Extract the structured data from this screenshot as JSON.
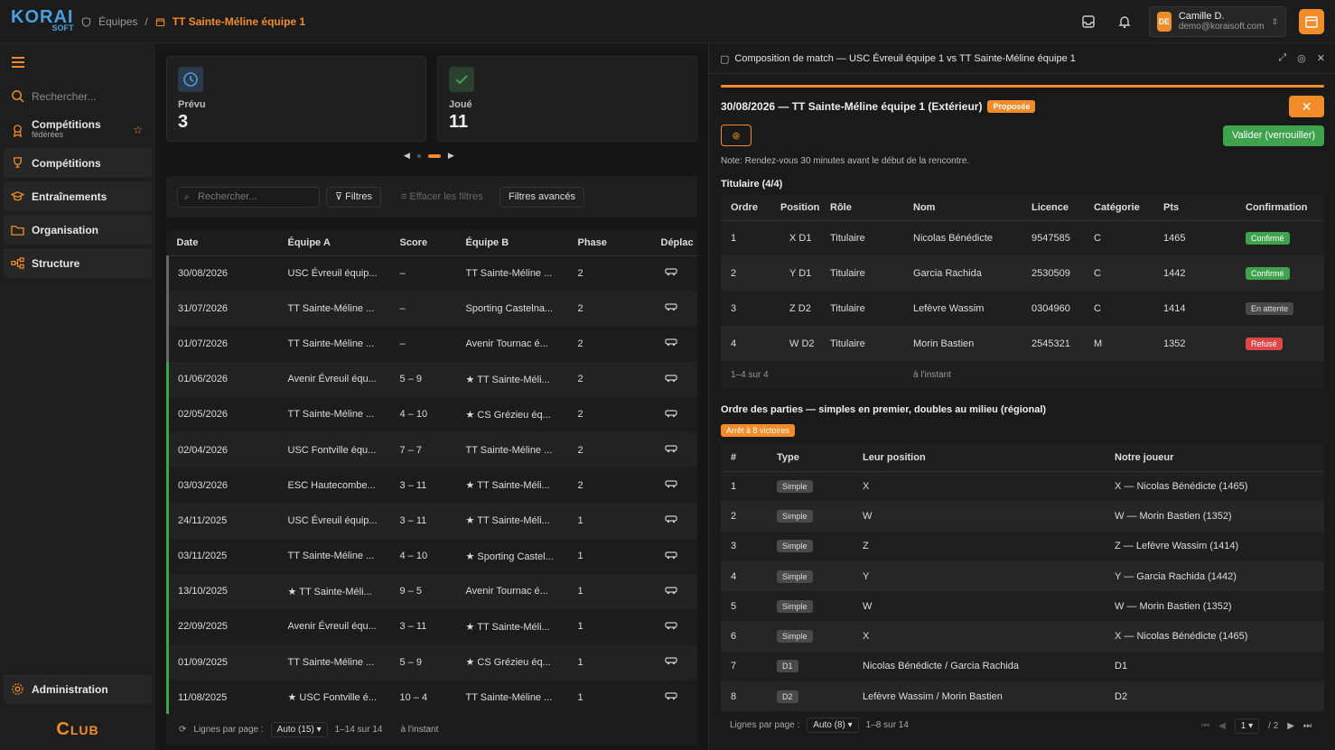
{
  "topbar": {
    "logo": "KORAI",
    "logo_sub": "SOFT",
    "breadcrumb": [
      "Équipes",
      "TT Sainte-Méline équipe 1"
    ],
    "user_initials": "DE",
    "user_name": "Camille D.",
    "user_email": "demo@koraisoft.com"
  },
  "sidebar": {
    "search_placeholder": "Rechercher...",
    "fed_label": "Compétitions",
    "fed_sub": "fédérées",
    "items": [
      "Compétitions",
      "Entraînements",
      "Organisation",
      "Structure"
    ],
    "admin": "Administration",
    "club": "Club"
  },
  "stats": [
    {
      "label": "Prévu",
      "value": "3"
    },
    {
      "label": "Joué",
      "value": "11"
    }
  ],
  "filters": {
    "search_placeholder": "Rechercher...",
    "filters": "Filtres",
    "clear": "Effacer les filtres",
    "advanced": "Filtres avancés"
  },
  "matches": {
    "columns": [
      "Date",
      "Équipe A",
      "Score",
      "Équipe B",
      "Phase",
      "Déplac"
    ],
    "rows": [
      {
        "date": "30/08/2026",
        "a": "USC Évreuil équip...",
        "score": "–",
        "b": "TT Sainte-Méline ...",
        "phase": "2",
        "played": false
      },
      {
        "date": "31/07/2026",
        "a": "TT Sainte-Méline ...",
        "score": "–",
        "b": "Sporting Castelna...",
        "phase": "2",
        "played": false
      },
      {
        "date": "01/07/2026",
        "a": "TT Sainte-Méline ...",
        "score": "–",
        "b": "Avenir Tournac é...",
        "phase": "2",
        "played": false
      },
      {
        "date": "01/06/2026",
        "a": "Avenir Évreuil équ...",
        "score": "5 – 9",
        "b": "★ TT Sainte-Méli...",
        "phase": "2",
        "played": true
      },
      {
        "date": "02/05/2026",
        "a": "TT Sainte-Méline ...",
        "score": "4 – 10",
        "b": "★ CS Grézieu éq...",
        "phase": "2",
        "played": true
      },
      {
        "date": "02/04/2026",
        "a": "USC Fontville équ...",
        "score": "7 – 7",
        "b": "TT Sainte-Méline ...",
        "phase": "2",
        "played": true
      },
      {
        "date": "03/03/2026",
        "a": "ESC Hautecombe...",
        "score": "3 – 11",
        "b": "★ TT Sainte-Méli...",
        "phase": "2",
        "played": true
      },
      {
        "date": "24/11/2025",
        "a": "USC Évreuil équip...",
        "score": "3 – 11",
        "b": "★ TT Sainte-Méli...",
        "phase": "1",
        "played": true
      },
      {
        "date": "03/11/2025",
        "a": "TT Sainte-Méline ...",
        "score": "4 – 10",
        "b": "★ Sporting Castel...",
        "phase": "1",
        "played": true
      },
      {
        "date": "13/10/2025",
        "a": "★ TT Sainte-Méli...",
        "score": "9 – 5",
        "b": "Avenir Tournac é...",
        "phase": "1",
        "played": true
      },
      {
        "date": "22/09/2025",
        "a": "Avenir Évreuil équ...",
        "score": "3 – 11",
        "b": "★ TT Sainte-Méli...",
        "phase": "1",
        "played": true
      },
      {
        "date": "01/09/2025",
        "a": "TT Sainte-Méline ...",
        "score": "5 – 9",
        "b": "★ CS Grézieu éq...",
        "phase": "1",
        "played": true
      },
      {
        "date": "11/08/2025",
        "a": "★ USC Fontville é...",
        "score": "10 – 4",
        "b": "TT Sainte-Méline ...",
        "phase": "1",
        "played": true
      }
    ],
    "footer_label": "Lignes par page :",
    "footer_select": "Auto (15)",
    "footer_range": "1–14 sur 14",
    "footer_time": "à l'instant"
  },
  "panel": {
    "header": "Composition de match — USC Évreuil équipe 1 vs TT Sainte-Méline équipe 1",
    "title": "30/08/2026 — TT Sainte-Méline équipe 1 (Extérieur)",
    "status": "Proposée",
    "validate": "Valider (verrouiller)",
    "note": "Note: Rendez-vous 30 minutes avant le début de la rencontre.",
    "titulaire_title": "Titulaire (4/4)",
    "titulaire_columns": [
      "Ordre",
      "Position",
      "Rôle",
      "Nom",
      "Licence",
      "Catégorie",
      "Pts",
      "Confirmation"
    ],
    "titulaire": [
      {
        "ordre": "1",
        "pos": "X D1",
        "role": "Titulaire",
        "nom": "Nicolas Bénédicte",
        "lic": "9547585",
        "cat": "C",
        "pts": "1465",
        "conf": "Confirmé",
        "conf_kind": "ok"
      },
      {
        "ordre": "2",
        "pos": "Y D1",
        "role": "Titulaire",
        "nom": "Garcia Rachida",
        "lic": "2530509",
        "cat": "C",
        "pts": "1442",
        "conf": "Confirmé",
        "conf_kind": "ok"
      },
      {
        "ordre": "3",
        "pos": "Z D2",
        "role": "Titulaire",
        "nom": "Lefèvre Wassim",
        "lic": "0304960",
        "cat": "C",
        "pts": "1414",
        "conf": "En attente",
        "conf_kind": "wait"
      },
      {
        "ordre": "4",
        "pos": "W D2",
        "role": "Titulaire",
        "nom": "Morin Bastien",
        "lic": "2545321",
        "cat": "M",
        "pts": "1352",
        "conf": "Refusé",
        "conf_kind": "no"
      }
    ],
    "titulaire_footer": "1–4 sur 4",
    "titulaire_time": "à l'instant",
    "order_title": "Ordre des parties — simples en premier, doubles au milieu (régional)",
    "order_badge": "Arrêt à 8 victoires",
    "order_columns": [
      "#",
      "Type",
      "Leur position",
      "Notre joueur"
    ],
    "order": [
      {
        "n": "1",
        "type": "Simple",
        "leur": "X",
        "notre": "X — Nicolas Bénédicte (1465)"
      },
      {
        "n": "2",
        "type": "Simple",
        "leur": "W",
        "notre": "W — Morin Bastien (1352)"
      },
      {
        "n": "3",
        "type": "Simple",
        "leur": "Z",
        "notre": "Z — Lefèvre Wassim (1414)"
      },
      {
        "n": "4",
        "type": "Simple",
        "leur": "Y",
        "notre": "Y — Garcia Rachida (1442)"
      },
      {
        "n": "5",
        "type": "Simple",
        "leur": "W",
        "notre": "W — Morin Bastien (1352)"
      },
      {
        "n": "6",
        "type": "Simple",
        "leur": "X",
        "notre": "X — Nicolas Bénédicte (1465)"
      },
      {
        "n": "7",
        "type": "D1",
        "leur": "Nicolas Bénédicte / Garcia Rachida",
        "notre": "D1"
      },
      {
        "n": "8",
        "type": "D2",
        "leur": "Lefèvre Wassim / Morin Bastien",
        "notre": "D2"
      }
    ],
    "footer_label": "Lignes par page :",
    "footer_select": "Auto (8)",
    "footer_range": "1–8 sur 14",
    "page": "1",
    "page_total": "/ 2"
  },
  "colors": {
    "accent": "#f28c28",
    "success": "#3fa34d",
    "danger": "#e04848",
    "brand": "#4a9fe0"
  }
}
